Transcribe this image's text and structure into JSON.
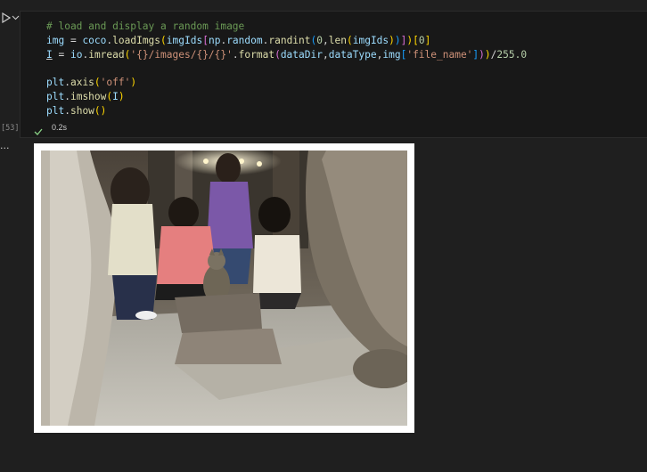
{
  "cell": {
    "execution_count": "[53]",
    "status_time": "0.2s",
    "code_lines": [
      [
        {
          "t": "# load and display a random image",
          "c": "c-com"
        }
      ],
      [
        {
          "t": "img",
          "c": "c-var"
        },
        {
          "t": " = ",
          "c": "c-op"
        },
        {
          "t": "coco",
          "c": "c-var"
        },
        {
          "t": ".",
          "c": "c-op"
        },
        {
          "t": "loadImgs",
          "c": "c-fn"
        },
        {
          "t": "(",
          "c": "c-p1"
        },
        {
          "t": "imgIds",
          "c": "c-var"
        },
        {
          "t": "[",
          "c": "c-p2"
        },
        {
          "t": "np",
          "c": "c-var"
        },
        {
          "t": ".",
          "c": "c-op"
        },
        {
          "t": "random",
          "c": "c-var"
        },
        {
          "t": ".",
          "c": "c-op"
        },
        {
          "t": "randint",
          "c": "c-fn"
        },
        {
          "t": "(",
          "c": "c-p3"
        },
        {
          "t": "0",
          "c": "c-num"
        },
        {
          "t": ",",
          "c": "c-op"
        },
        {
          "t": "len",
          "c": "c-fn"
        },
        {
          "t": "(",
          "c": "c-p1"
        },
        {
          "t": "imgIds",
          "c": "c-var"
        },
        {
          "t": ")",
          "c": "c-p1"
        },
        {
          "t": ")",
          "c": "c-p3"
        },
        {
          "t": "]",
          "c": "c-p2"
        },
        {
          "t": ")",
          "c": "c-p1"
        },
        {
          "t": "[",
          "c": "c-p1"
        },
        {
          "t": "0",
          "c": "c-num"
        },
        {
          "t": "]",
          "c": "c-p1"
        }
      ],
      [
        {
          "t": "I",
          "c": "c-var cursor-u"
        },
        {
          "t": " = ",
          "c": "c-op"
        },
        {
          "t": "io",
          "c": "c-var"
        },
        {
          "t": ".",
          "c": "c-op"
        },
        {
          "t": "imread",
          "c": "c-fn"
        },
        {
          "t": "(",
          "c": "c-p1"
        },
        {
          "t": "'{}/images/{}/{}'",
          "c": "c-str"
        },
        {
          "t": ".",
          "c": "c-op"
        },
        {
          "t": "format",
          "c": "c-fn"
        },
        {
          "t": "(",
          "c": "c-p2"
        },
        {
          "t": "dataDir",
          "c": "c-var"
        },
        {
          "t": ",",
          "c": "c-op"
        },
        {
          "t": "dataType",
          "c": "c-var"
        },
        {
          "t": ",",
          "c": "c-op"
        },
        {
          "t": "img",
          "c": "c-var"
        },
        {
          "t": "[",
          "c": "c-p3"
        },
        {
          "t": "'file_name'",
          "c": "c-str"
        },
        {
          "t": "]",
          "c": "c-p3"
        },
        {
          "t": ")",
          "c": "c-p2"
        },
        {
          "t": ")",
          "c": "c-p1"
        },
        {
          "t": "/",
          "c": "c-op"
        },
        {
          "t": "255.0",
          "c": "c-num"
        }
      ],
      [],
      [
        {
          "t": "plt",
          "c": "c-var"
        },
        {
          "t": ".",
          "c": "c-op"
        },
        {
          "t": "axis",
          "c": "c-fn"
        },
        {
          "t": "(",
          "c": "c-p1"
        },
        {
          "t": "'off'",
          "c": "c-str"
        },
        {
          "t": ")",
          "c": "c-p1"
        }
      ],
      [
        {
          "t": "plt",
          "c": "c-var"
        },
        {
          "t": ".",
          "c": "c-op"
        },
        {
          "t": "imshow",
          "c": "c-fn"
        },
        {
          "t": "(",
          "c": "c-p1"
        },
        {
          "t": "I",
          "c": "c-var"
        },
        {
          "t": ")",
          "c": "c-p1"
        }
      ],
      [
        {
          "t": "plt",
          "c": "c-var"
        },
        {
          "t": ".",
          "c": "c-op"
        },
        {
          "t": "show",
          "c": "c-fn"
        },
        {
          "t": "()",
          "c": "c-p1"
        }
      ]
    ]
  },
  "output": {
    "ellipsis": "···",
    "image_alt": "Photo of people sitting around a cat inside a marble interior"
  },
  "colors": {
    "background": "#1f1f1f",
    "cell_bg": "#181818",
    "success": "#89d185"
  },
  "icons": {
    "run": "run-icon",
    "dropdown": "chevron-down-icon",
    "status": "check-icon"
  }
}
